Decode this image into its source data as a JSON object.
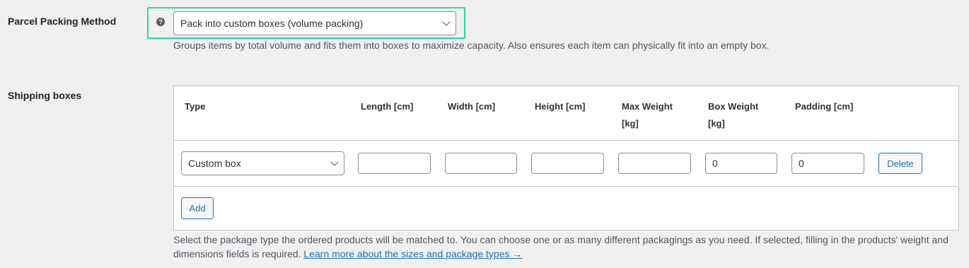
{
  "packing": {
    "label": "Parcel Packing Method",
    "help_icon": "question-icon",
    "help_glyph": "?",
    "selected_value": "Pack into custom boxes (volume packing)",
    "description": "Groups items by total volume and fits them into boxes to maximize capacity. Also ensures each item can physically fit into an empty box.",
    "highlight_color": "#2fd3a6"
  },
  "boxes": {
    "label": "Shipping boxes",
    "columns": [
      "Type",
      "Length [cm]",
      "Width [cm]",
      "Height [cm]",
      "Max Weight",
      "Box Weight",
      "Padding [cm]"
    ],
    "columns_line2": [
      "",
      "",
      "",
      "",
      "[kg]",
      "[kg]",
      ""
    ],
    "rows": [
      {
        "type": "Custom box",
        "length": "",
        "width": "",
        "height": "",
        "max_weight": "",
        "box_weight": "0",
        "padding": "0",
        "delete_label": "Delete"
      }
    ],
    "add_label": "Add",
    "description": "Select the package type the ordered products will be matched to. You can choose one or as many different packagings as you need. If selected, filling in the products' weight and dimensions fields is required.",
    "link_text": "Learn more about the sizes and package types →",
    "link_color": "#2271b1"
  }
}
